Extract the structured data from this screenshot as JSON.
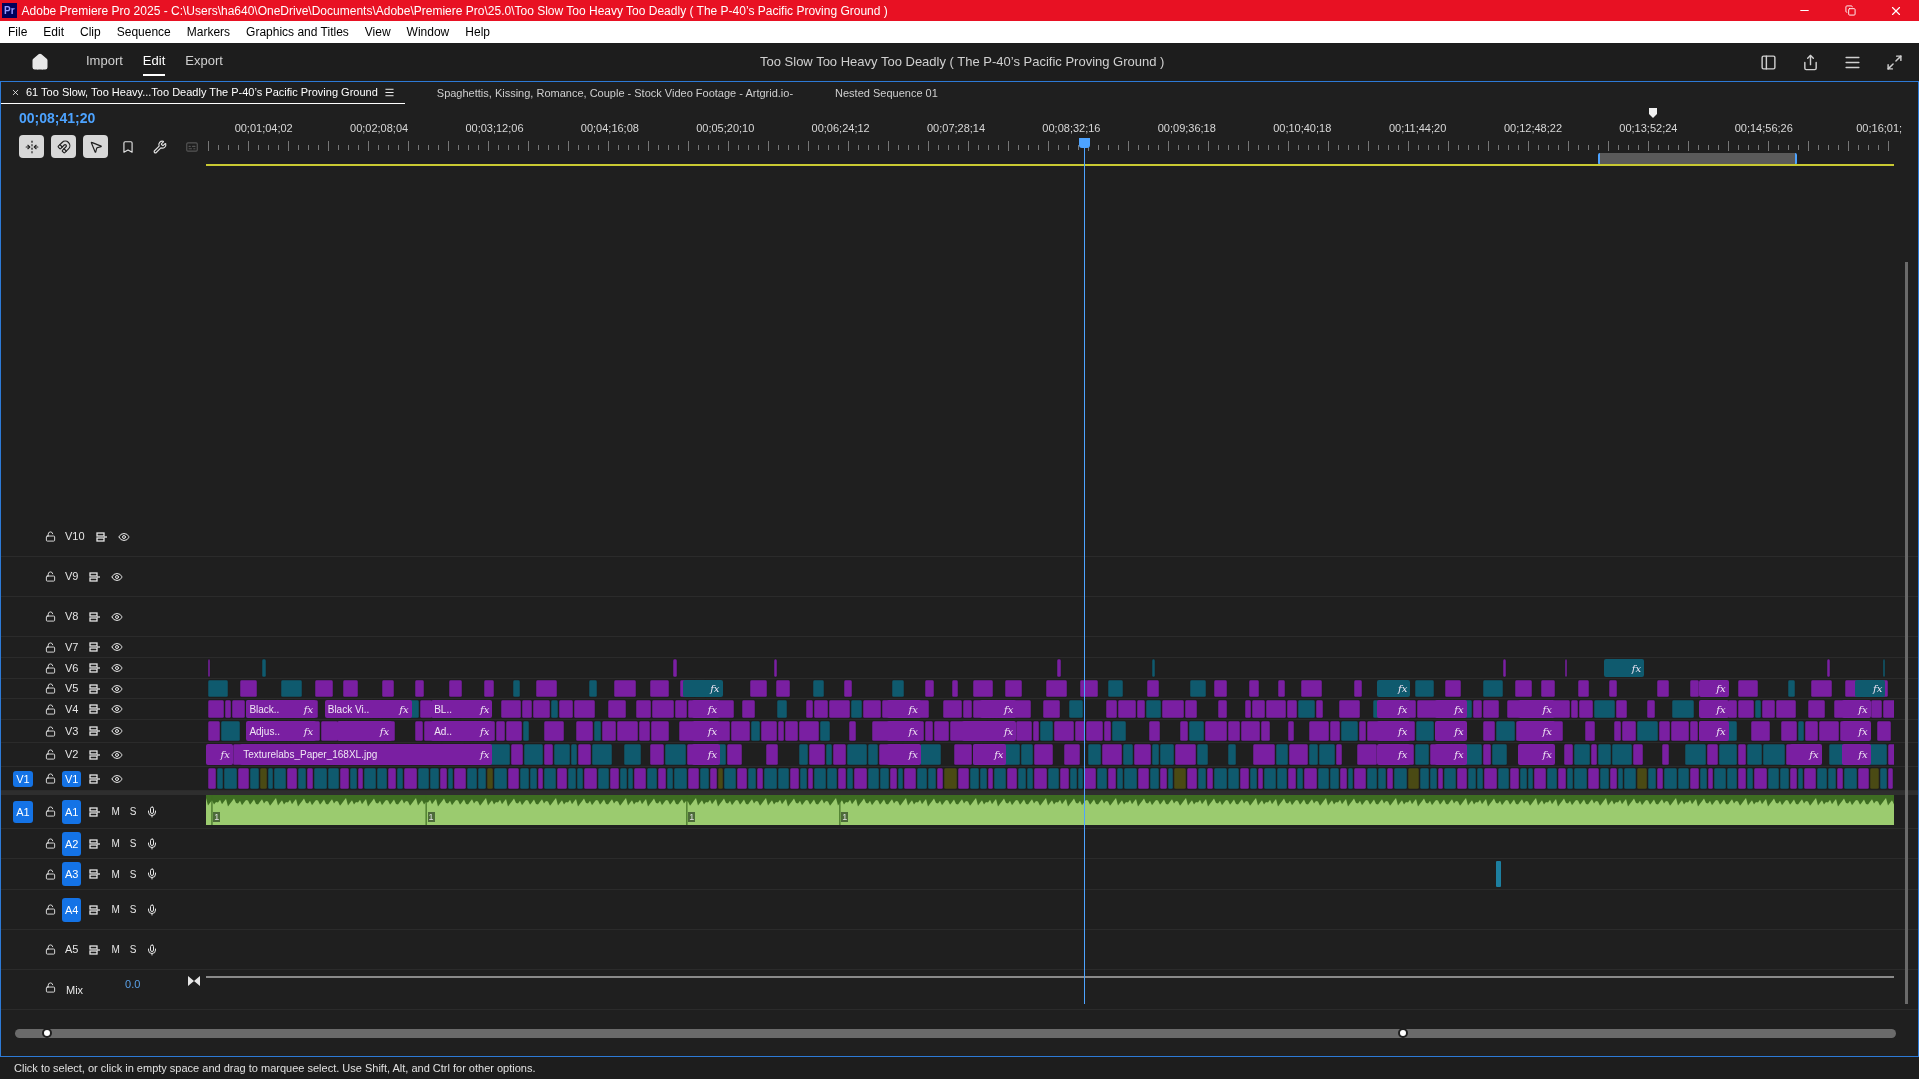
{
  "window": {
    "title": "Adobe Premiere Pro 2025 - C:\\Users\\ha640\\OneDrive\\Documents\\Adobe\\Premiere Pro\\25.0\\Too Slow Too Heavy Too Deadly ( The P-40’s Pacific Proving Ground  )",
    "app_badge": "Pr"
  },
  "menu": [
    "File",
    "Edit",
    "Clip",
    "Sequence",
    "Markers",
    "Graphics and Titles",
    "View",
    "Window",
    "Help"
  ],
  "workspace_tabs": [
    {
      "label": "Import",
      "selected": false
    },
    {
      "label": "Edit",
      "selected": true
    },
    {
      "label": "Export",
      "selected": false
    }
  ],
  "project_title": "Too Slow Too Heavy Too Deadly ( The P-40’s Pacific Proving Ground  )",
  "sequence_tabs": [
    {
      "label": "61 Too Slow, Too Heavy...Too Deadly The P-40’s Pacific Proving Ground",
      "selected": true
    },
    {
      "label": "Spaghettis, Kissing, Romance, Couple - Stock Video Footage - Artgrid.io-",
      "selected": false
    },
    {
      "label": "Nested Sequence 01",
      "selected": false
    }
  ],
  "timecode": "00;08;41;20",
  "tools": [
    {
      "kind": "insert",
      "on": true
    },
    {
      "kind": "snap",
      "on": true
    },
    {
      "kind": "linked",
      "on": true
    },
    {
      "kind": "marker",
      "on": false
    },
    {
      "kind": "settings",
      "on": false
    },
    {
      "kind": "captions",
      "on": false,
      "disabled": true
    }
  ],
  "ruler_labels": [
    "00;01;04;02",
    "00;02;08;04",
    "00;03;12;06",
    "00;04;16;08",
    "00;05;20;10",
    "00;06;24;12",
    "00;07;28;14",
    "00;08;32;16",
    "00;09;36;18",
    "00;10;40;18",
    "00;11;44;20",
    "00;12;48;22",
    "00;13;52;24",
    "00;14;56;26",
    "00;16;01;"
  ],
  "video_tracks": [
    {
      "name": "V10",
      "targeted": false
    },
    {
      "name": "V9",
      "targeted": false
    },
    {
      "name": "V8",
      "targeted": false
    },
    {
      "name": "V7",
      "targeted": false
    },
    {
      "name": "V6",
      "targeted": false,
      "clips": [
        {
          "fx": "fx",
          "color": "#0f5a6e"
        }
      ]
    },
    {
      "name": "V5",
      "targeted": false,
      "clips": [
        {
          "fx": "fx",
          "color": "#0f5a6e"
        },
        {
          "fx": "fx",
          "color": "#0f5a6e"
        },
        {
          "fx": "fx",
          "color": "#7a1fa2"
        },
        {
          "fx": "fx",
          "color": "#0f5a6e"
        }
      ]
    },
    {
      "name": "V4",
      "targeted": false,
      "clips": [
        {
          "label": "Black..",
          "fx": "fx",
          "color": "#7a1fa2"
        },
        {
          "label": "Black Vi..",
          "fx": "fx",
          "color": "#7a1fa2"
        },
        {
          "label": "BL..",
          "fx": "fx",
          "color": "#7a1fa2"
        },
        {
          "fx": "fx",
          "color": "#7a1fa2"
        },
        {
          "fx": "fx",
          "color": "#7a1fa2"
        },
        {
          "fx": "fx",
          "color": "#7a1fa2"
        },
        {
          "fx": "fx",
          "color": "#7a1fa2"
        },
        {
          "fx": "fx",
          "color": "#7a1fa2"
        },
        {
          "fx": "fx",
          "color": "#7a1fa2"
        },
        {
          "fx": "fx",
          "color": "#7a1fa2"
        },
        {
          "fx": "fx",
          "color": "#7a1fa2"
        }
      ]
    },
    {
      "name": "V3",
      "targeted": false,
      "clips": [
        {
          "label": "Adjus..",
          "fx": "fx",
          "color": "#7a1fa2"
        },
        {
          "fx": "fx",
          "color": "#7a1fa2"
        },
        {
          "label": "Ad..",
          "fx": "fx",
          "color": "#7a1fa2"
        },
        {
          "fx": "fx",
          "color": "#7a1fa2"
        },
        {
          "fx": "fx",
          "color": "#7a1fa2"
        },
        {
          "fx": "fx",
          "color": "#7a1fa2"
        },
        {
          "fx": "fx",
          "color": "#7a1fa2"
        },
        {
          "fx": "fx",
          "color": "#7a1fa2"
        },
        {
          "fx": "fx",
          "color": "#7a1fa2"
        },
        {
          "fx": "fx",
          "color": "#7a1fa2"
        },
        {
          "fx": "fx",
          "color": "#7a1fa2"
        }
      ]
    },
    {
      "name": "V2",
      "targeted": false,
      "clips": [
        {
          "fx": "fx",
          "color": "#7a1fa2"
        },
        {
          "label": "Texturelabs_Paper_168XL.jpg",
          "fx": "fx",
          "color": "#7a1fa2"
        },
        {
          "fx": "fx",
          "color": "#7a1fa2"
        },
        {
          "fx": "fx",
          "color": "#7a1fa2"
        },
        {
          "fx": "fx",
          "color": "#7a1fa2"
        },
        {
          "fx": "fx",
          "color": "#7a1fa2"
        },
        {
          "fx": "fx",
          "color": "#7a1fa2"
        },
        {
          "fx": "fx",
          "color": "#7a1fa2"
        },
        {
          "fx": "fx",
          "color": "#7a1fa2"
        },
        {
          "fx": "fx",
          "color": "#7a1fa2"
        }
      ]
    },
    {
      "name": "V1",
      "targeted": true,
      "source_patch": "V1"
    }
  ],
  "audio_tracks": [
    {
      "name": "A1",
      "targeted": true,
      "source_patch": "A1",
      "mute": "M",
      "solo": "S",
      "clip_marks": [
        "1",
        "1",
        "1",
        "1"
      ]
    },
    {
      "name": "A2",
      "targeted": true,
      "mute": "M",
      "solo": "S"
    },
    {
      "name": "A3",
      "targeted": true,
      "mute": "M",
      "solo": "S"
    },
    {
      "name": "A4",
      "targeted": true,
      "mute": "M",
      "solo": "S"
    },
    {
      "name": "A5",
      "targeted": false,
      "mute": "M",
      "solo": "S"
    }
  ],
  "mix_track": {
    "name": "Mix",
    "value": "0.0"
  },
  "status_bar": "Click to select, or click in empty space and drag to marquee select. Use Shift, Alt, and Ctrl for other options."
}
